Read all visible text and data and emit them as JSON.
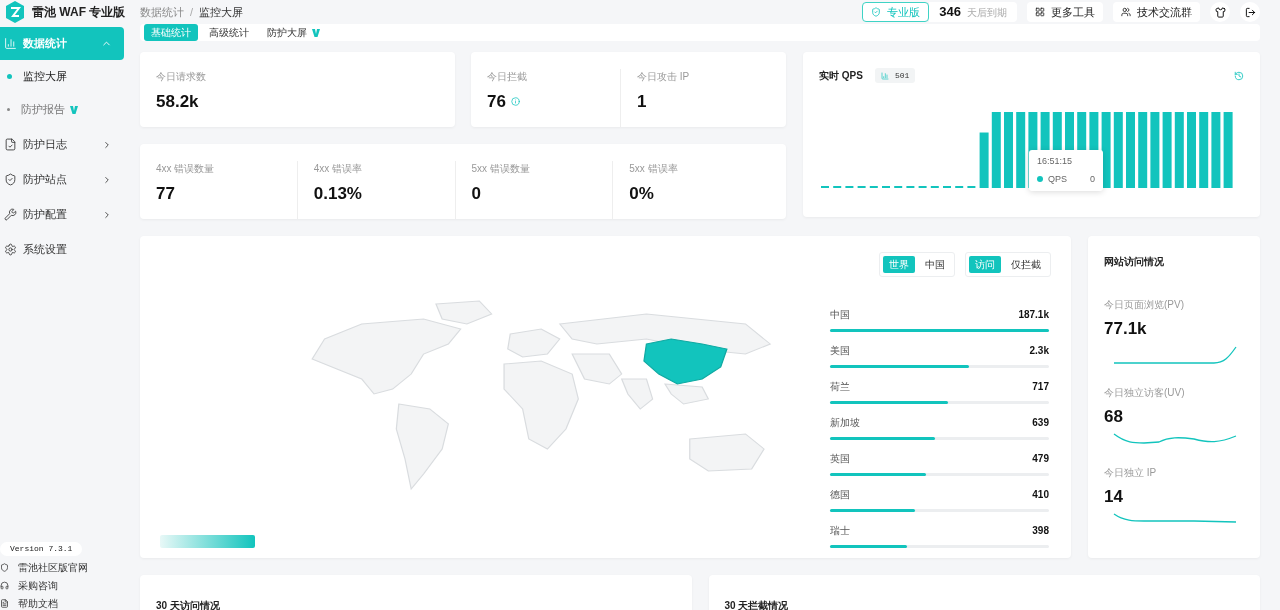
{
  "header": {
    "logo_text": "雷池 WAF 专业版",
    "breadcrumb": [
      "数据统计",
      "监控大屏"
    ],
    "breadcrumb_separator": "/",
    "edition": "专业版",
    "days_left": "346",
    "days_left_label": "天后到期",
    "actions": [
      "更多工具",
      "技术交流群"
    ]
  },
  "sidebar": {
    "items": [
      {
        "label": "数据统计",
        "kind": "group",
        "expanded": true,
        "selected": true,
        "children": [
          {
            "label": "监控大屏",
            "selected": true,
            "pro": false
          },
          {
            "label": "防护报告",
            "selected": false,
            "pro": true
          }
        ]
      },
      {
        "label": "防护日志",
        "kind": "group",
        "expanded": false,
        "selected": false
      },
      {
        "label": "防护站点",
        "kind": "group",
        "expanded": false,
        "selected": false
      },
      {
        "label": "防护配置",
        "kind": "group",
        "expanded": false,
        "selected": false
      },
      {
        "label": "系统设置",
        "kind": "link",
        "selected": false
      }
    ],
    "version": "Version 7.3.1",
    "links": [
      "雷池社区版官网",
      "采购咨询",
      "帮助文档"
    ]
  },
  "tabs": [
    {
      "label": "基础统计",
      "selected": true,
      "pro": false
    },
    {
      "label": "高级统计",
      "selected": false,
      "pro": false
    },
    {
      "label": "防护大屏",
      "selected": false,
      "pro": true
    }
  ],
  "stat_cards": [
    {
      "items": [
        {
          "label": "今日请求数",
          "value": "58.2k",
          "info": false
        }
      ]
    },
    {
      "items": [
        {
          "label": "今日拦截",
          "value": "76",
          "info": true
        },
        {
          "label": "今日攻击 IP",
          "value": "1",
          "info": false
        }
      ]
    }
  ],
  "error_card": {
    "items": [
      {
        "label": "4xx 错误数量",
        "value": "77"
      },
      {
        "label": "4xx 错误率",
        "value": "0.13%"
      },
      {
        "label": "5xx 错误数量",
        "value": "0"
      },
      {
        "label": "5xx 错误率",
        "value": "0%"
      }
    ]
  },
  "qps": {
    "title": "实时 QPS",
    "current": "501",
    "tooltip": {
      "time": "16:51:15",
      "series": "QPS",
      "value": "0"
    }
  },
  "map": {
    "toggles": [
      {
        "options": [
          {
            "label": "世界",
            "selected": true
          },
          {
            "label": "中国",
            "selected": false
          }
        ]
      },
      {
        "options": [
          {
            "label": "访问",
            "selected": true
          },
          {
            "label": "仅拦截",
            "selected": false
          }
        ]
      }
    ],
    "countries": [
      {
        "name": "中国",
        "value": "187.1k",
        "level": 1
      },
      {
        "name": "美国",
        "value": "2.3k",
        "level": 0.635
      },
      {
        "name": "荷兰",
        "value": "717",
        "level": 0.54
      },
      {
        "name": "新加坡",
        "value": "639",
        "level": 0.48
      },
      {
        "name": "英国",
        "value": "479",
        "level": 0.44
      },
      {
        "name": "德国",
        "value": "410",
        "level": 0.39
      },
      {
        "name": "瑞士",
        "value": "398",
        "level": 0.35
      }
    ]
  },
  "site_visits": {
    "title": "网站访问情况",
    "metrics": [
      {
        "label": "今日页面浏览(PV)",
        "value": "77.1k"
      },
      {
        "label": "今日独立访客(UV)",
        "value": "68"
      },
      {
        "label": "今日独立 IP",
        "value": "14"
      }
    ]
  },
  "bottom_cards": [
    "30 天访问情况",
    "30 天拦截情况"
  ]
}
